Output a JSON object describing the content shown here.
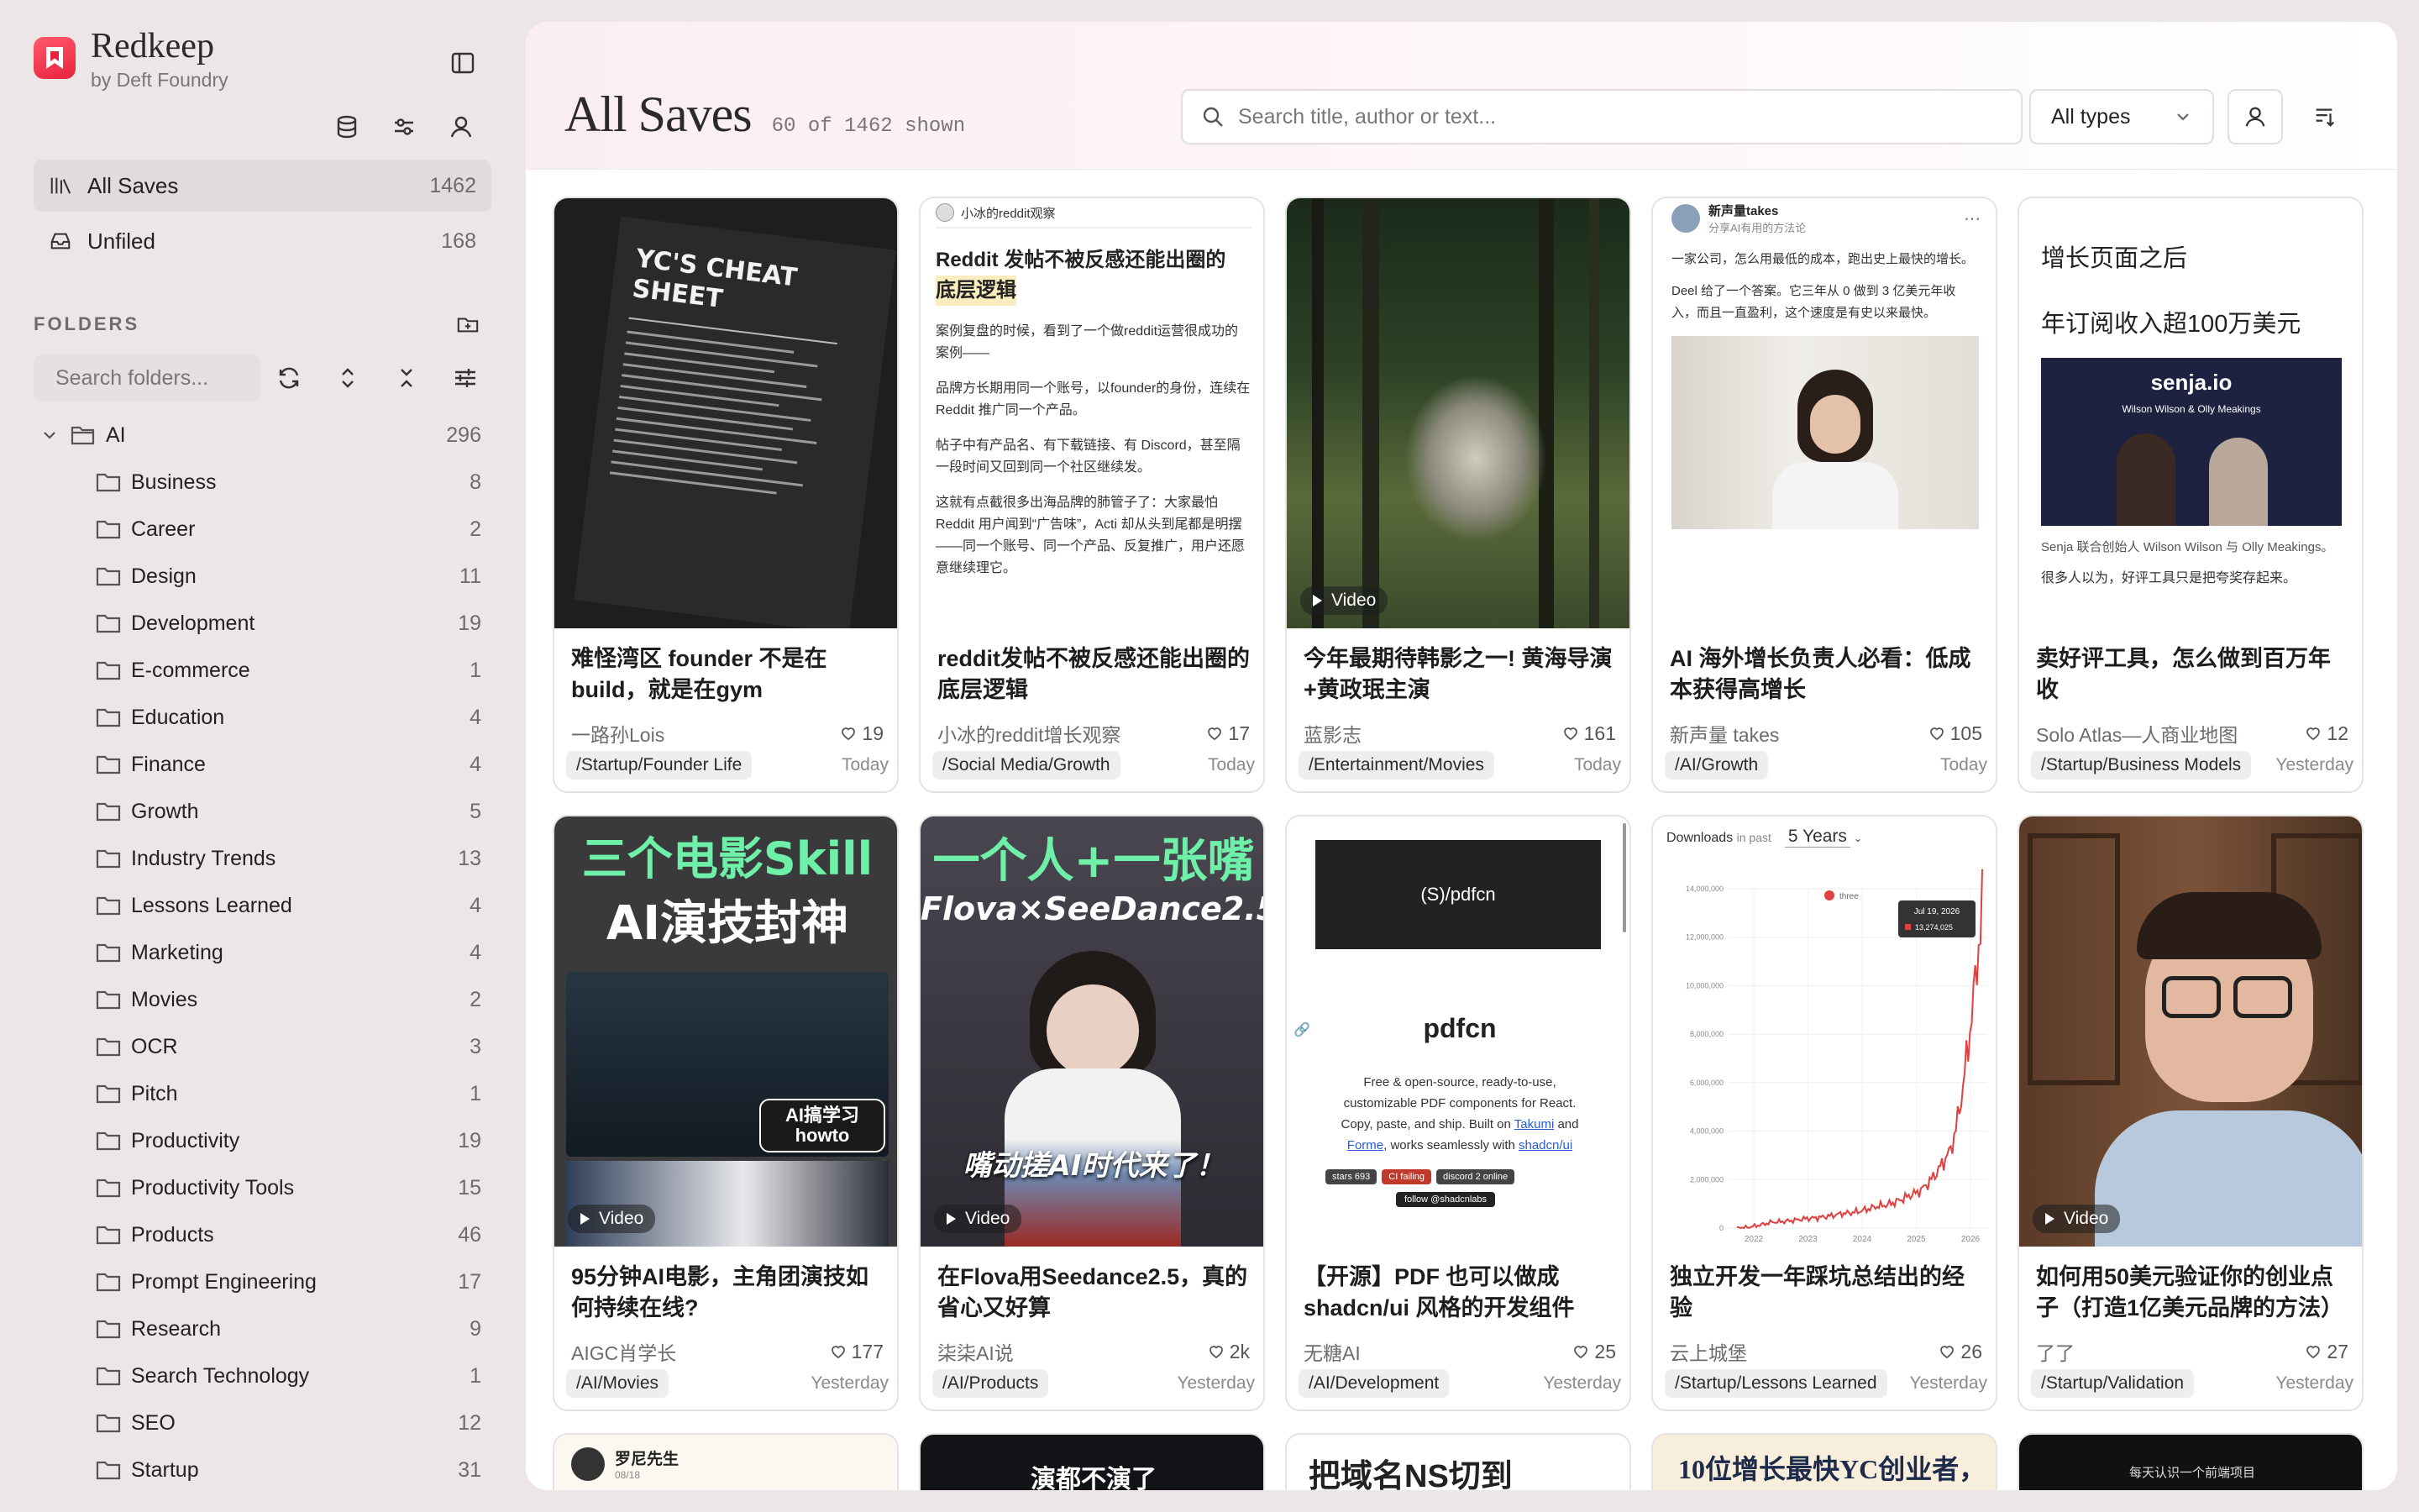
{
  "app": {
    "name": "Redkeep",
    "byline": "by Deft Foundry"
  },
  "nav": [
    {
      "label": "All Saves",
      "count": "1462",
      "active": true
    },
    {
      "label": "Unfiled",
      "count": "168",
      "active": false
    }
  ],
  "folders": {
    "title": "FOLDERS",
    "search_placeholder": "Search folders...",
    "root": {
      "label": "AI",
      "count": "296"
    },
    "children": [
      {
        "label": "Business",
        "count": "8"
      },
      {
        "label": "Career",
        "count": "2"
      },
      {
        "label": "Design",
        "count": "11"
      },
      {
        "label": "Development",
        "count": "19"
      },
      {
        "label": "E-commerce",
        "count": "1"
      },
      {
        "label": "Education",
        "count": "4"
      },
      {
        "label": "Finance",
        "count": "4"
      },
      {
        "label": "Growth",
        "count": "5"
      },
      {
        "label": "Industry Trends",
        "count": "13"
      },
      {
        "label": "Lessons Learned",
        "count": "4"
      },
      {
        "label": "Marketing",
        "count": "4"
      },
      {
        "label": "Movies",
        "count": "2"
      },
      {
        "label": "OCR",
        "count": "3"
      },
      {
        "label": "Pitch",
        "count": "1"
      },
      {
        "label": "Productivity",
        "count": "19"
      },
      {
        "label": "Productivity Tools",
        "count": "15"
      },
      {
        "label": "Products",
        "count": "46"
      },
      {
        "label": "Prompt Engineering",
        "count": "17"
      },
      {
        "label": "Research",
        "count": "9"
      },
      {
        "label": "Search Technology",
        "count": "1"
      },
      {
        "label": "SEO",
        "count": "12"
      },
      {
        "label": "Startup",
        "count": "31"
      }
    ]
  },
  "header": {
    "title": "All Saves",
    "subtitle": "60 of 1462 shown",
    "search_placeholder": "Search title, author or text...",
    "type_filter": "All types"
  },
  "cards": [
    {
      "title": "难怪湾区 founder 不是在build，就是在gym",
      "author": "一路孙Lois",
      "likes": "19",
      "folder": "/Startup/Founder Life",
      "when": "Today",
      "video": false,
      "thumb": {
        "heading": "YC'S CHEAT SHEET"
      }
    },
    {
      "title": "reddit发帖不被反感还能出圈的底层逻辑",
      "author": "小冰的reddit增长观察",
      "likes": "17",
      "folder": "/Social Media/Growth",
      "when": "Today",
      "video": false,
      "thumb": {
        "source": "小冰的reddit观察",
        "heading": "Reddit 发帖不被反感还能出圈的",
        "heading2": "底层逻辑",
        "lines": [
          "案例复盘的时候，看到了一个做reddit运营很成功的案例——",
          "品牌方长期用同一个账号，以founder的身份，连续在 Reddit 推广同一个产品。",
          "帖子中有产品名、有下载链接、有 Discord，甚至隔一段时间又回到同一个社区继续发。",
          "这就有点截很多出海品牌的肺管子了：大家最怕 Reddit 用户闻到“广告味”，Acti 却从头到尾都是明摆——同一个账号、同一个产品、反复推广，用户还愿意继续理它。"
        ]
      }
    },
    {
      "title": "今年最期待韩影之一! 黄海导演+黄政珉主演",
      "author": "蓝影志",
      "likes": "161",
      "folder": "/Entertainment/Movies",
      "when": "Today",
      "video": true,
      "video_label": "Video",
      "thumb": {}
    },
    {
      "title": "AI 海外增长负责人必看：低成本获得高增长",
      "author": "新声量 takes",
      "likes": "105",
      "folder": "/AI/Growth",
      "when": "Today",
      "video": false,
      "thumb": {
        "source": "新声量takes",
        "source_sub": "分享AI有用的方法论",
        "lines": [
          "一家公司，怎么用最低的成本，跑出史上最快的增长。",
          "Deel 给了一个答案。它三年从 0 做到 3 亿美元年收入，而且一直盈利，这个速度是有史以来最快。"
        ]
      }
    },
    {
      "title": "卖好评工具，怎么做到百万年收",
      "author": "Solo Atlas—人商业地图",
      "likes": "12",
      "folder": "/Startup/Business Models",
      "when": "Yesterday",
      "video": false,
      "thumb": {
        "heading": "增长页面之后",
        "heading2": "年订阅收入超100万美元",
        "brand": "senja.io",
        "brand_sub": "Wilson Wilson & Olly Meakings",
        "caption": "Senja 联合创始人 Wilson Wilson 与 Olly Meakings。",
        "caption2": "很多人以为，好评工具只是把夸奖存起来。"
      }
    },
    {
      "title": "95分钟AI电影，主角团演技如何持续在线?",
      "author": "AIGC肖学长",
      "likes": "177",
      "folder": "/AI/Movies",
      "when": "Yesterday",
      "video": true,
      "video_label": "Video",
      "thumb": {
        "heading": "三个电影Skill",
        "heading2": "AI演技封神",
        "badge": "AI搞学习 howto"
      }
    },
    {
      "title": "在Flova用Seedance2.5，真的省心又好算",
      "author": "柒柒AI说",
      "likes": "2k",
      "folder": "/AI/Products",
      "when": "Yesterday",
      "video": true,
      "video_label": "Video",
      "thumb": {
        "heading": "一个人+一张嘴",
        "heading2": "Flova×SeeDance2.5",
        "heading3": "嘴动搓AI时代来了！"
      }
    },
    {
      "title": "【开源】PDF 也可以做成shadcn/ui 风格的开发组件了。",
      "author": "无糖AI",
      "likes": "25",
      "folder": "/AI/Development",
      "when": "Yesterday",
      "video": false,
      "thumb": {
        "logo": "(S)/pdfcn",
        "name": "pdfcn",
        "desc1": "Free & open-source, ready-to-use,",
        "desc2": "customizable PDF components for React.",
        "desc3": "Copy, paste, and ship. Built on",
        "link1": "Takumi",
        "and": "and",
        "link2": "Forme",
        "desc4": ", works seamlessly with",
        "link3": "shadcn/ui",
        "badges": [
          "stars 693",
          "CI failing",
          "discord 2 online",
          "follow @shadcnlabs"
        ]
      }
    },
    {
      "title": "独立开发一年踩坑总结出的经验",
      "author": "云上城堡",
      "likes": "26",
      "folder": "/Startup/Lessons Learned",
      "when": "Yesterday",
      "video": false,
      "thumb": {
        "label": "Downloads",
        "label_sub": "in past",
        "period": "5 Years",
        "legend": "three",
        "tooltip_date": "Jul 19, 2026",
        "tooltip_value": "13,274,025"
      }
    },
    {
      "title": "如何用50美元验证你的创业点子（打造1亿美元品牌的方法）",
      "author": "了了",
      "likes": "27",
      "folder": "/Startup/Validation",
      "when": "Yesterday",
      "video": true,
      "video_label": "Video",
      "thumb": {}
    }
  ],
  "chart_data": {
    "type": "line",
    "title": "Downloads",
    "series": [
      {
        "name": "three",
        "values": [
          0,
          250000,
          400000,
          600000,
          900000,
          1400000,
          3000000,
          13274025
        ]
      }
    ],
    "x": [
      "2022",
      "2023",
      "2024",
      "2025",
      "2026"
    ],
    "ylim": [
      0,
      14000000
    ],
    "yticks": [
      "0",
      "2,000,000",
      "4,000,000",
      "6,000,000",
      "8,000,000",
      "10,000,000",
      "12,000,000",
      "14,000,000"
    ],
    "color": "#e0403f"
  },
  "partial_cards": [
    {
      "source": "罗尼先生",
      "date": "08/18"
    },
    {
      "heading": "演都不演了"
    },
    {
      "heading": "把域名NS切到"
    },
    {
      "heading": "10位增长最快YC创业者，"
    },
    {
      "caption": "每天认识一个前端项目"
    }
  ],
  "colors": {
    "accent": "#e8233d",
    "active_nav": "#e1dcdb",
    "sidebar_bg": "#ece7e6"
  }
}
